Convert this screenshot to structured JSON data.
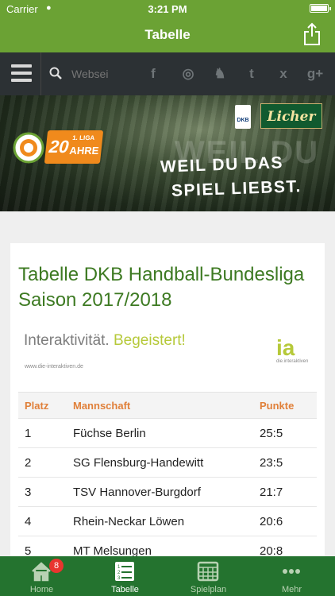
{
  "status": {
    "carrier": "Carrier",
    "time": "3:21 PM"
  },
  "nav": {
    "title": "Tabelle"
  },
  "toolbar": {
    "search_placeholder": "Websei",
    "social": [
      "f",
      "◎",
      "♞",
      "t",
      "x",
      "g+"
    ]
  },
  "banner": {
    "liga_text": "1. LIGA",
    "years_number": "20",
    "years_word": "AHRE",
    "slogan_line1": "WEIL DU DAS",
    "slogan_line2": "SPIEL LIEBST.",
    "watermark": "WEIL DU",
    "sponsor": "Licher",
    "dkb": "DKB"
  },
  "card": {
    "title": "Tabelle DKB Handball-Bundesliga Saison 2017/2018",
    "ad_main": "Interaktivität.",
    "ad_accent": "Begeistert!",
    "ad_url": "www.die-interaktiven.de",
    "ad_logo": "ia",
    "ad_logo_sub": "die.interaktiven"
  },
  "table": {
    "headers": {
      "platz": "Platz",
      "mannschaft": "Mannschaft",
      "punkte": "Punkte"
    },
    "rows": [
      {
        "platz": "1",
        "team": "Füchse Berlin",
        "punkte": "25:5"
      },
      {
        "platz": "2",
        "team": "SG Flensburg-Handewitt",
        "punkte": "23:5"
      },
      {
        "platz": "3",
        "team": "TSV Hannover-Burgdorf",
        "punkte": "21:7"
      },
      {
        "platz": "4",
        "team": "Rhein-Neckar Löwen",
        "punkte": "20:6"
      },
      {
        "platz": "5",
        "team": "MT Melsungen",
        "punkte": "20:8"
      }
    ]
  },
  "tabs": [
    {
      "label": "Home",
      "badge": "8"
    },
    {
      "label": "Tabelle"
    },
    {
      "label": "Spielplan"
    },
    {
      "label": "Mehr"
    }
  ]
}
